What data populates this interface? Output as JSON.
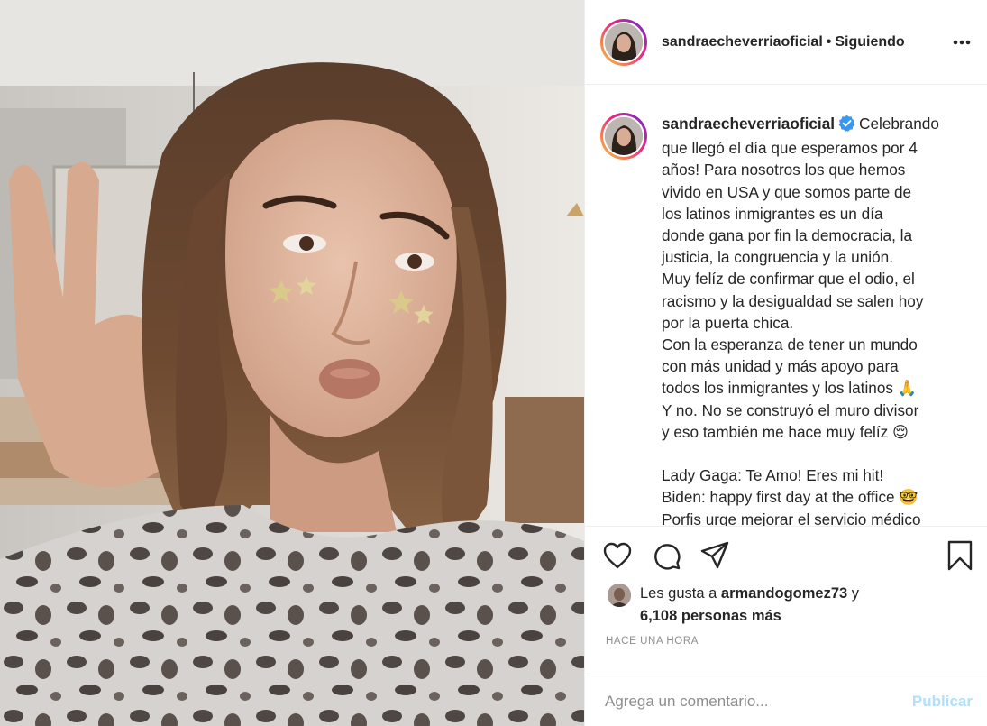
{
  "header": {
    "username": "sandraecheverriaoficial",
    "separator": "•",
    "follow_status": "Siguiendo",
    "more_icon": "more-horizontal-icon"
  },
  "caption": {
    "username": "sandraecheverriaoficial",
    "first_line": "Celebrando",
    "lines": [
      "que llegó el día que esperamos por 4",
      "años! Para nosotros los que hemos",
      "vivido en USA y que somos parte de",
      "los latinos inmigrantes es un día",
      "donde gana por fin la democracia, la",
      "justicia, la congruencia y la unión.",
      "Muy felíz de confirmar que el odio, el",
      "racismo y la desigualdad se salen hoy",
      "por la puerta chica.",
      "Con la esperanza de tener un mundo",
      "con más unidad y más apoyo para",
      "todos los inmigrantes y los latinos 🙏",
      "Y no. No se construyó el muro divisor",
      "y eso también me hace muy felíz 😌",
      "",
      "Lady Gaga: Te Amo! Eres mi hit!",
      "Biden: happy first day at the office 🤓",
      "Porfis urge mejorar el servicio médico"
    ]
  },
  "actions": {
    "like_icon": "heart-icon",
    "comment_icon": "comment-icon",
    "share_icon": "paper-plane-icon",
    "save_icon": "bookmark-icon"
  },
  "likes": {
    "prefix": "Les gusta a",
    "user": "armandogomez73",
    "connector": "y",
    "others": "6,108 personas más"
  },
  "timestamp": "HACE UNA HORA",
  "comment_box": {
    "placeholder": "Agrega un comentario...",
    "submit_label": "Publicar"
  },
  "colors": {
    "story_ring_start": "#f9ce34",
    "story_ring_mid": "#ee2a7b",
    "story_ring_end": "#6228d7",
    "verified": "#3897f0",
    "publish_disabled": "#b2dffc",
    "muted_text": "#8e8e8e"
  }
}
